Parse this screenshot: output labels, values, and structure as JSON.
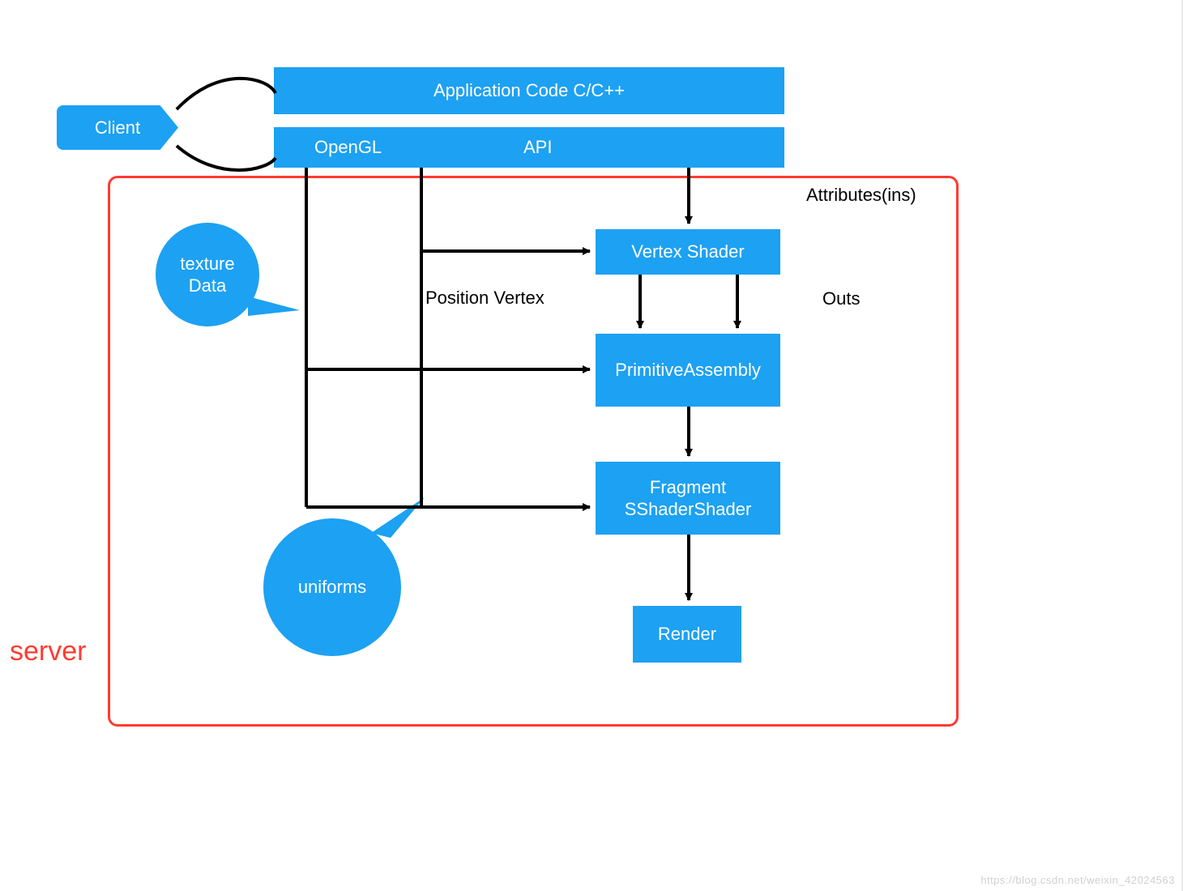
{
  "client_tag": "Client",
  "app_code": "Application Code C/C++",
  "api_bar": {
    "left": "OpenGL",
    "right": "API"
  },
  "server_label": "server",
  "callouts": {
    "texture": "texture\nData",
    "uniforms": "uniforms"
  },
  "labels": {
    "attributes": "Attributes(ins)",
    "position_vertex": "Position Vertex",
    "outs": "Outs"
  },
  "nodes": {
    "vertex_shader": "Vertex Shader",
    "primitive_assembly": "PrimitiveAssembly",
    "fragment_shader": "Fragment SShaderShader",
    "render": "Render"
  },
  "watermark": "https://blog.csdn.net/weixin_42024563"
}
